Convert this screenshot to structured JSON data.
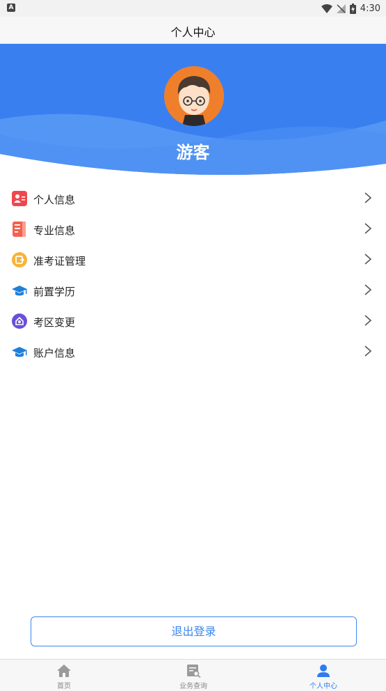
{
  "status_bar": {
    "time": "4:30",
    "left_badge": "A"
  },
  "header": {
    "title": "个人中心"
  },
  "profile": {
    "username": "游客"
  },
  "menu": {
    "items": [
      {
        "label": "个人信息",
        "icon": "id-card-icon"
      },
      {
        "label": "专业信息",
        "icon": "book-icon"
      },
      {
        "label": "准考证管理",
        "icon": "ticket-icon"
      },
      {
        "label": "前置学历",
        "icon": "graduation-cap-icon"
      },
      {
        "label": "考区变更",
        "icon": "location-icon"
      },
      {
        "label": "账户信息",
        "icon": "graduation-cap-icon"
      }
    ]
  },
  "logout": {
    "label": "退出登录"
  },
  "tabs": [
    {
      "label": "首页",
      "icon": "home-icon"
    },
    {
      "label": "业务查询",
      "icon": "search-document-icon"
    },
    {
      "label": "个人中心",
      "icon": "user-icon",
      "active": true
    }
  ],
  "colors": {
    "primary": "#2e7cf0",
    "hero_dark": "#3a7ff0",
    "hero_light": "#5d9df5"
  }
}
